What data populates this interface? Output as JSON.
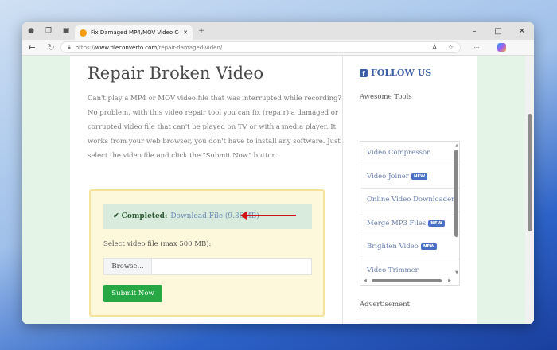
{
  "browser": {
    "tab_title": "Fix Damaged MP4/MOV Video Co",
    "url_scheme": "https://",
    "url_host": "www.fileconverto.com",
    "url_path": "/repair-damaged-video/",
    "read_aloud": "À",
    "more": "···"
  },
  "main": {
    "title": "Repair Broken Video",
    "intro": "Can't play a MP4 or MOV video file that was interrupted while recording? No problem, with this video repair tool you can fix (repair) a damaged or corrupted video file that can't be played on TV or with a media player. It works from your web browser, you don't have to install any software. Just select the video file and click the \"Submit Now\" button.",
    "completed_label": "✔ Completed:",
    "download_link": "Download File (9.36MB)",
    "select_label": "Select video file (max 500 MB):",
    "browse": "Browse...",
    "submit": "Submit Now"
  },
  "sidebar": {
    "follow": "FOLLOW US",
    "awesome": "Awesome Tools",
    "new_badge": "NEW",
    "tools": [
      {
        "label": "Video Compressor",
        "new": false
      },
      {
        "label": "Video Joiner",
        "new": true
      },
      {
        "label": "Online Video Downloader",
        "new": false
      },
      {
        "label": "Merge MP3 Files",
        "new": true
      },
      {
        "label": "Brighten Video",
        "new": true
      },
      {
        "label": "Video Trimmer",
        "new": false
      }
    ],
    "advertisement": "Advertisement"
  }
}
